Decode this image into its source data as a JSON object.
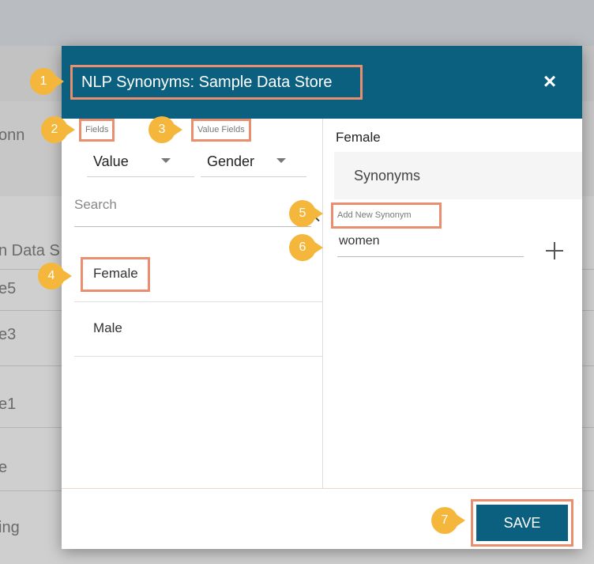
{
  "background": {
    "fragments": [
      "onn",
      "n Data S",
      "e5",
      "e3",
      "e1",
      "e",
      "ing"
    ]
  },
  "modal": {
    "title": "NLP Synonyms: Sample Data Store",
    "close_icon": "×"
  },
  "left": {
    "fields_label": "Fields",
    "value_fields_label": "Value Fields",
    "field_dropdown": {
      "selected": "Value"
    },
    "value_field_dropdown": {
      "selected": "Gender"
    },
    "search": {
      "placeholder": "Search",
      "value": ""
    },
    "items": [
      {
        "label": "Female"
      },
      {
        "label": "Male"
      }
    ]
  },
  "right": {
    "selected_value": "Female",
    "synonyms_header": "Synonyms",
    "add_label": "Add New Synonym",
    "synonym_input": {
      "value": "women"
    }
  },
  "footer": {
    "save_label": "SAVE"
  },
  "markers": [
    "1",
    "2",
    "3",
    "4",
    "5",
    "6",
    "7"
  ],
  "colors": {
    "header": "#0b6080",
    "highlight_border": "#e98f6f",
    "marker": "#f4b73c"
  }
}
